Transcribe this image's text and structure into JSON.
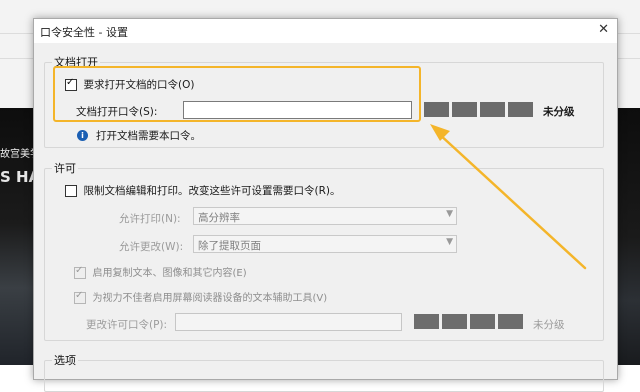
{
  "background": {
    "side_text_1": "故宫美学",
    "side_text_2": "S HA"
  },
  "dialog": {
    "title": "口令安全性 - 设置",
    "close_glyph": "✕"
  },
  "open_section": {
    "legend": "文档打开",
    "require_checkbox_label": "要求打开文档的口令(O)",
    "require_checked": true,
    "password_label": "文档打开口令(S):",
    "password_value": "",
    "strength_text": "未分级",
    "info_text": "打开文档需要本口令。"
  },
  "permissions_section": {
    "legend": "许可",
    "restrict_label": "限制文档编辑和打印。改变这些许可设置需要口令(R)。",
    "restrict_checked": false,
    "allow_print_label": "允许打印(N):",
    "allow_print_value": "高分辨率",
    "allow_change_label": "允许更改(W):",
    "allow_change_value": "除了提取页面",
    "enable_copy_label": "启用复制文本、图像和其它内容(E)",
    "enable_copy_checked": true,
    "enable_screen_reader_label": "为视力不佳者启用屏幕阅读器设备的文本辅助工具(V)",
    "enable_screen_reader_checked": true,
    "change_password_label": "更改许可口令(P):",
    "change_password_value": "",
    "strength_text": "未分级"
  },
  "options_section": {
    "legend": "选项"
  },
  "colors": {
    "highlight": "#f4b52a",
    "info_icon": "#1b5fb3"
  }
}
